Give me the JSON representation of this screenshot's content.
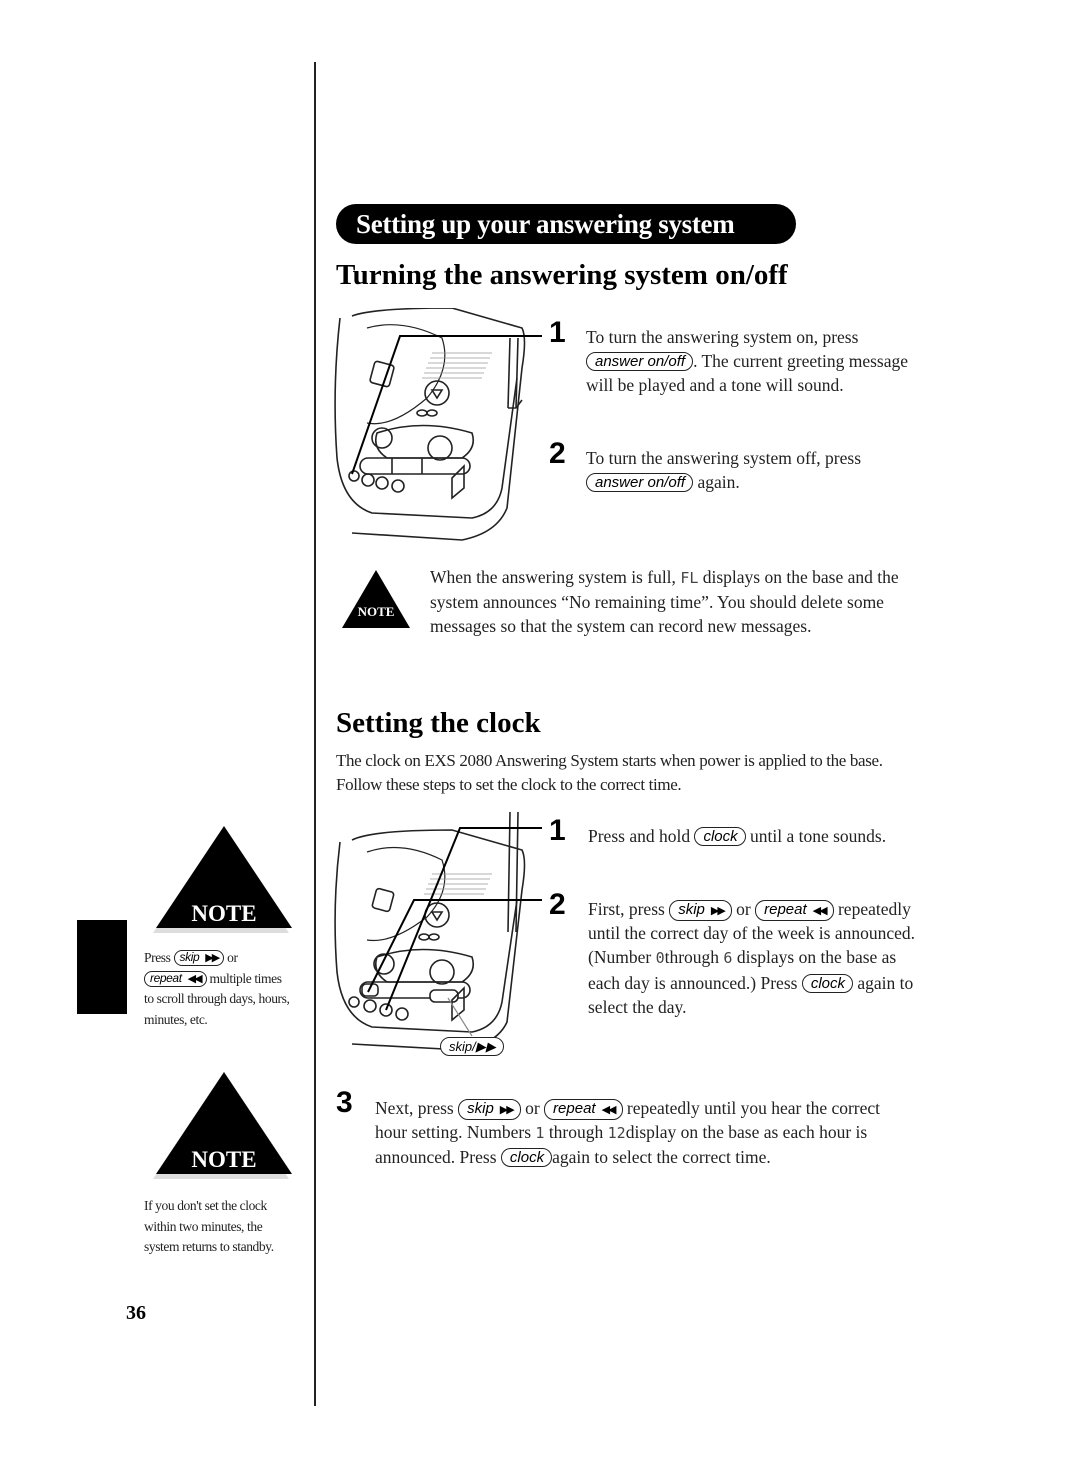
{
  "page": {
    "section_banner": "Setting up your answering system",
    "page_number": "36"
  },
  "turning": {
    "title": "Turning the answering system on/off",
    "steps": [
      {
        "num": "1",
        "pre": "To turn the answering system on, press",
        "key": "answer on/off",
        "post": ". The current greeting message will be played and a tone will sound."
      },
      {
        "num": "2",
        "pre": "To turn the answering system off, press",
        "key": "answer on/off",
        "post": "again."
      }
    ],
    "note": {
      "icon_label": "NOTE",
      "pre": "When the answering system is full,",
      "lcd": "FL",
      "post": "displays on the base and the system announces “No remaining time”. You should delete some messages so that the system can record new messages."
    }
  },
  "clock": {
    "title": "Setting the clock",
    "intro": "The clock on EXS 2080 Answering System starts when power is applied to the base. Follow these steps to set the clock to the correct time.",
    "diagram_label": "skip/▶▶",
    "step1": {
      "num": "1",
      "pre": "Press and hold",
      "key": "clock",
      "post": "until a tone sounds."
    },
    "step2": {
      "num": "2",
      "pre": "First, press",
      "key1": "skip",
      "key1_arrow": "▶▶",
      "mid": "or",
      "key2": "repeat",
      "key2_arrow": "◀◀",
      "text1": "repeatedly until the correct day of the week is announced. (Number",
      "lcd1": "0",
      "text2": "through",
      "lcd2": "6",
      "text3": "displays on the base as each day is announced.) Press",
      "key3": "clock",
      "text4": "again to select the day."
    },
    "step3": {
      "num": "3",
      "pre": "Next, press",
      "key1": "skip",
      "key1_arrow": "▶▶",
      "mid": "or",
      "key2": "repeat",
      "key2_arrow": "◀◀",
      "text1": "repeatedly until you hear the correct hour setting. Numbers",
      "lcd1": "1",
      "text2": "through",
      "lcd2": "12",
      "text3": "display on the base as each hour is announced. Press",
      "key3": "clock",
      "text4": "again to select the correct time."
    }
  },
  "sidebar": {
    "note1": {
      "icon_label": "NOTE",
      "pre": "Press",
      "key1": "skip",
      "key1_arrow": "▶▶",
      "mid": "or",
      "key2": "repeat",
      "key2_arrow": "◀◀",
      "post": "multiple times to scroll through days, hours, minutes, etc."
    },
    "note2": {
      "icon_label": "NOTE",
      "text": "If you don't set the clock within two minutes, the system returns to standby."
    }
  }
}
